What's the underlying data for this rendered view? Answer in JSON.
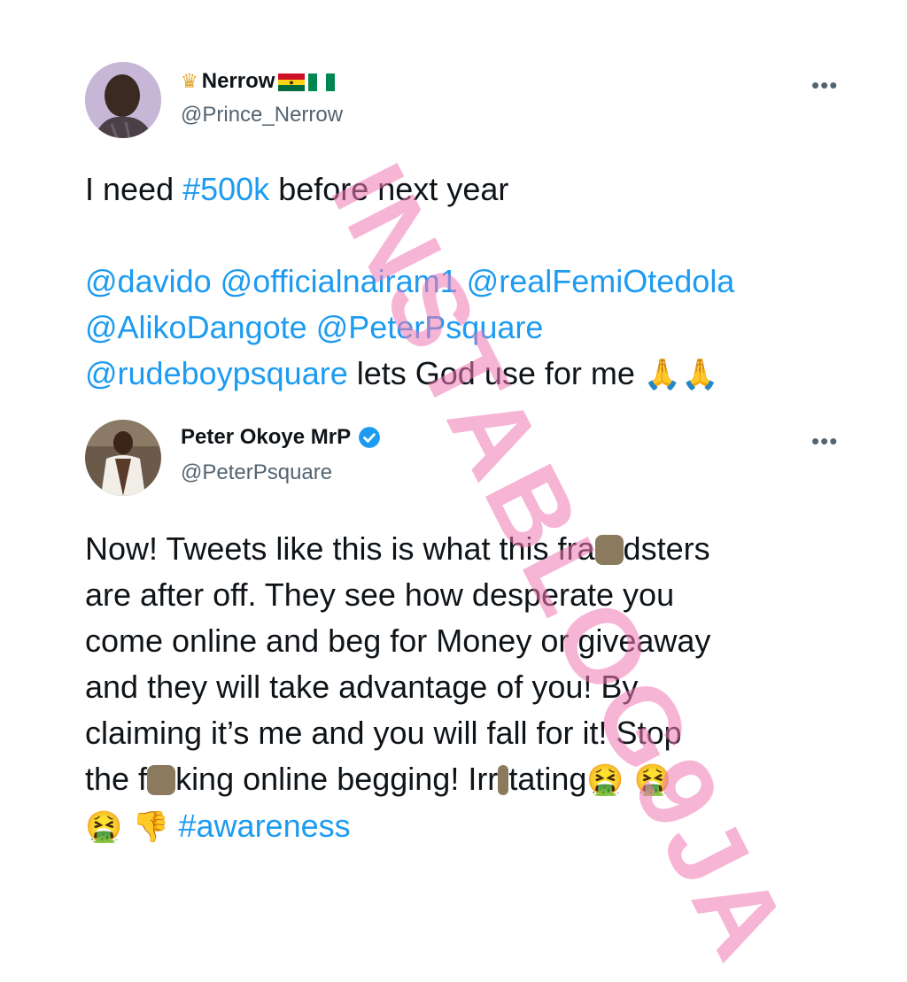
{
  "tweet1": {
    "display_name": "Nerrow",
    "handle": "@Prince_Nerrow",
    "more_label": "•••",
    "line1_pre": "I need ",
    "line1_link": "#500k",
    "line1_post": " before next year",
    "mention1": "@davido",
    "mention2": "@officialnairam1",
    "mention3": "@realFemiOtedola",
    "mention4": "@AlikoDangote",
    "mention5": "@PeterPsquare",
    "mention6": "@rudeboypsquare",
    "closing_text": " lets God use for me ",
    "emoji": "🙏🙏"
  },
  "tweet2": {
    "display_name": "Peter Okoye MrP",
    "handle": "@PeterPsquare",
    "more_label": "•••",
    "line1_a": "Now! Tweets like this is what this fra",
    "line1_b": "dsters",
    "line2": "are after off. They see how desperate you",
    "line3": "come online and beg for Money or giveaway",
    "line4": "and they will take advantage of you! By",
    "line5": "claiming it’s me and you will fall for it! Stop",
    "line6_a": "the f",
    "line6_b": "king online begging! Irr",
    "line6_c": "tating",
    "emoji_row": "🤮 🤮",
    "last_emoji": "🤮 👎",
    "hashtag": "#awareness"
  },
  "watermark": {
    "text": "INSTABLOG9JA"
  },
  "colors": {
    "link": "#1d9bf0",
    "verified": "#1d9bf0",
    "watermark": "#f078b4"
  }
}
